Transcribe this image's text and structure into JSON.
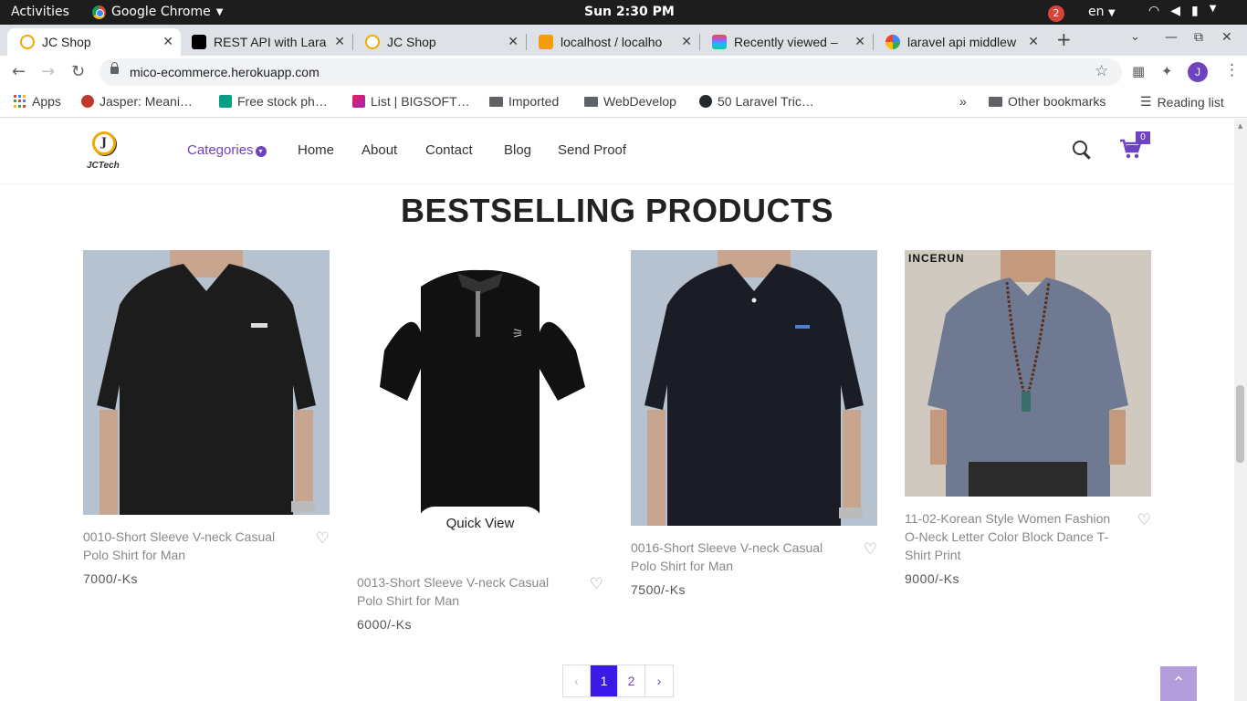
{
  "system_bar": {
    "activities": "Activities",
    "app_name": "Google Chrome",
    "clock": "Sun  2:30 PM",
    "notifications": "2",
    "language": "en"
  },
  "tabs": [
    {
      "title": "JC Shop",
      "active": true
    },
    {
      "title": "REST API with Lara"
    },
    {
      "title": "JC Shop"
    },
    {
      "title": "localhost / localho"
    },
    {
      "title": "Recently viewed –"
    },
    {
      "title": "laravel api middlew"
    }
  ],
  "address_bar": {
    "url": "mico-ecommerce.herokuapp.com",
    "profile_initial": "J"
  },
  "bookmarks": {
    "apps": "Apps",
    "items": [
      "Jasper: Meani…",
      "Free stock ph…",
      "List | BIGSOFT…",
      "Imported",
      "WebDevelop",
      "50 Laravel Tric…"
    ],
    "overflow": "»",
    "other": "Other bookmarks",
    "reading_list": "Reading list"
  },
  "site": {
    "logo_text": "JCTech",
    "logo_letter": "J",
    "nav": {
      "categories": "Categories",
      "home": "Home",
      "about": "About",
      "contact": "Contact",
      "blog": "Blog",
      "send_proof": "Send Proof"
    },
    "cart_count": "0",
    "accent_color": "#6f42c1"
  },
  "section_title": "BESTSELLING PRODUCTS",
  "products": [
    {
      "name": "0010-Short Sleeve V-neck Casual Polo Shirt for Man",
      "price": "7000/-Ks"
    },
    {
      "name": "0013-Short Sleeve V-neck Casual Polo Shirt for Man",
      "price": "6000/-Ks"
    },
    {
      "name": "0016-Short Sleeve V-neck Casual Polo Shirt for Man",
      "price": "7500/-Ks"
    },
    {
      "name": "11-02-Korean Style Women Fashion O-Neck Letter Color Block Dance T-Shirt Print",
      "price": "9000/-Ks",
      "brand_mark": "INCERUN"
    }
  ],
  "quick_view": "Quick View",
  "pagination": {
    "prev": "‹",
    "pages": [
      "1",
      "2"
    ],
    "current": "1",
    "next": "›"
  },
  "back_to_top": "⌃"
}
